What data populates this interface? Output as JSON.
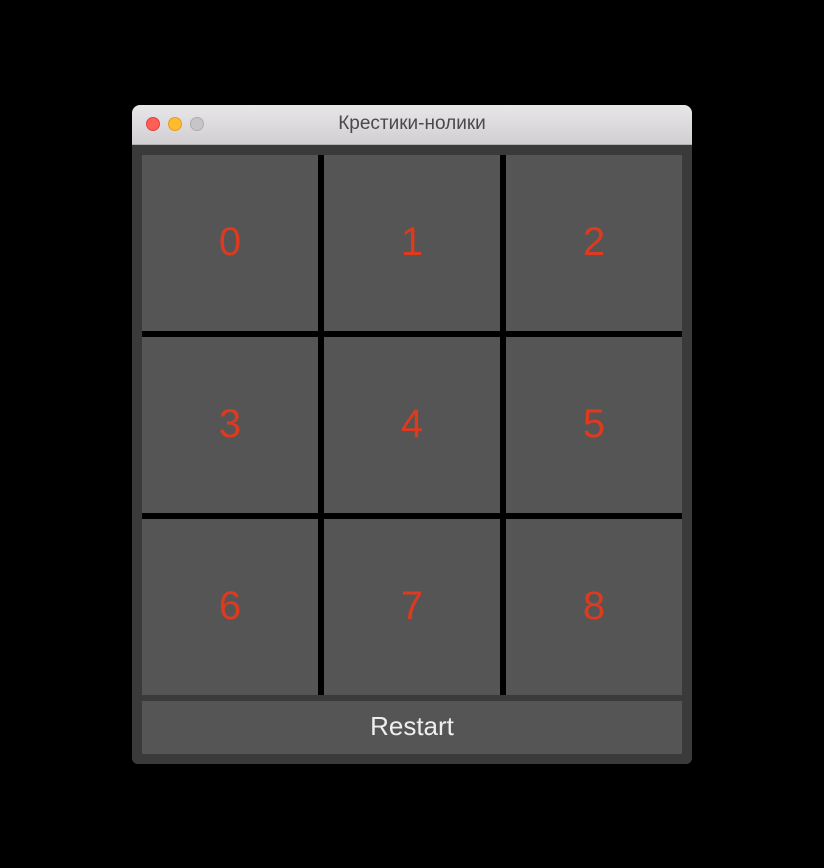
{
  "window": {
    "title": "Крестики-нолики"
  },
  "grid": {
    "cells": [
      "0",
      "1",
      "2",
      "3",
      "4",
      "5",
      "6",
      "7",
      "8"
    ]
  },
  "controls": {
    "restart_label": "Restart"
  },
  "colors": {
    "cell_bg": "#555555",
    "cell_text": "#dd3a1f",
    "window_bg": "#3a3a3a",
    "grid_gap": "#000000"
  }
}
